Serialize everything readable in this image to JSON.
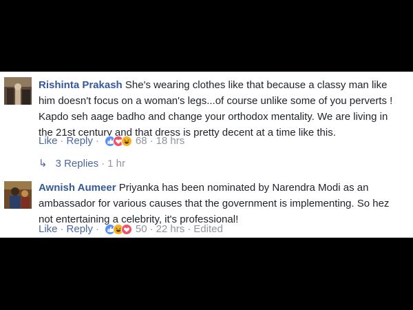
{
  "comments": [
    {
      "author": "Rishinta Prakash",
      "text": "She's wearing clothes like that because a classy man like him doesn't focus on a woman's legs...of course unlike some of you perverts ! Kapdo seh aage badho and change your orthodox mentality. We are living in the 21st century and that dress is pretty decent at a time like this.",
      "like_label": "Like",
      "reply_label": "Reply",
      "reaction_icons": [
        "like-reaction-icon",
        "love-reaction-icon",
        "haha-reaction-icon"
      ],
      "reaction_count": "68",
      "time": "18 hrs",
      "replies_label": "3 Replies",
      "replies_time": "1 hr"
    },
    {
      "author": "Awnish Aumeer",
      "text": "Priyanka has been nominated by Narendra Modi as an ambassador for various causes that the government is implementing. So hez not entertaining a celebrity, it's professional!",
      "like_label": "Like",
      "reply_label": "Reply",
      "reaction_icons": [
        "like-reaction-icon",
        "haha-reaction-icon",
        "love-reaction-icon"
      ],
      "reaction_count": "50",
      "time": "22 hrs",
      "edited_label": "Edited"
    }
  ],
  "colors": {
    "author": "#365899",
    "link": "#4b67a1",
    "meta": "#90949c",
    "background": "#000000",
    "panel": "#ffffff"
  }
}
